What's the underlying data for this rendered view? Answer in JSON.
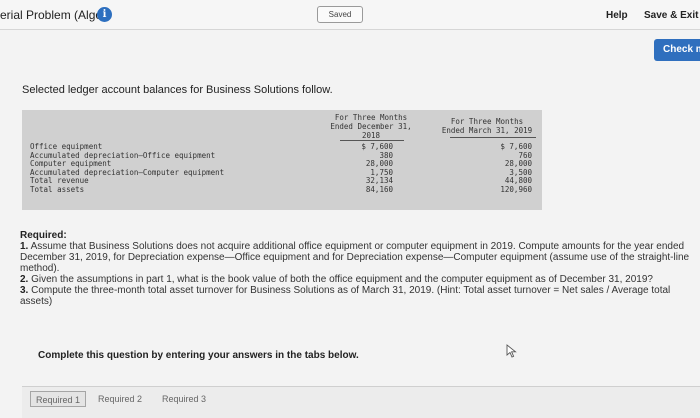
{
  "header": {
    "title": "erial Problem (Algo)",
    "info_icon": "i",
    "saved": "Saved",
    "help": "Help",
    "save_exit": "Save & Exit",
    "check": "Check m"
  },
  "intro": "Selected ledger account balances for Business Solutions follow.",
  "ledger": {
    "columns": [
      [
        "For Three Months",
        "Ended December 31,",
        "2018"
      ],
      [
        "For Three Months",
        "Ended March 31, 2019"
      ]
    ],
    "rows": [
      {
        "label": "Office equipment",
        "dec": "$ 7,600",
        "mar": "$ 7,600"
      },
      {
        "label": "Accumulated depreciation—Office equipment",
        "dec": "380",
        "mar": "760"
      },
      {
        "label": "Computer equipment",
        "dec": "28,000",
        "mar": "28,000"
      },
      {
        "label": "Accumulated depreciation—Computer equipment",
        "dec": "1,750",
        "mar": "3,500"
      },
      {
        "label": "Total revenue",
        "dec": "32,134",
        "mar": "44,800"
      },
      {
        "label": "Total assets",
        "dec": "84,160",
        "mar": "120,960"
      }
    ]
  },
  "required": {
    "heading": "Required:",
    "items": [
      {
        "num": "1.",
        "text": " Assume that Business Solutions does not acquire additional office equipment or computer equipment in 2019. Compute amounts for the year ended December 31, 2019, for Depreciation expense—Office equipment and for Depreciation expense—Computer equipment (assume use of the straight-line method)."
      },
      {
        "num": "2.",
        "text": " Given the assumptions in part 1, what is the book value of both the office equipment and the computer equipment as of December 31, 2019?"
      },
      {
        "num": "3.",
        "text": " Compute the three-month total asset turnover for Business Solutions as of March 31, 2019. (Hint: Total asset turnover = Net sales / Average total assets)"
      }
    ]
  },
  "complete_text": "Complete this question by entering your answers in the tabs below.",
  "tabs": [
    "Required 1",
    "Required 2",
    "Required 3"
  ],
  "colors": {
    "accent": "#2f6fbe",
    "info": "#2d6fbf"
  }
}
